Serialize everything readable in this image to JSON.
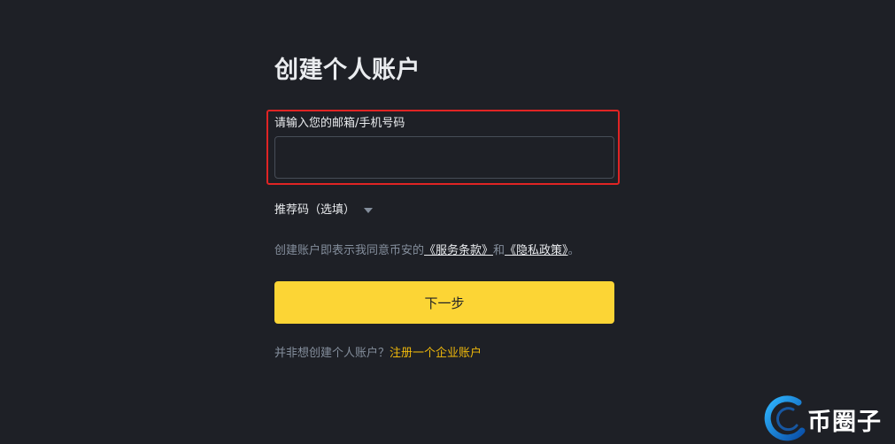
{
  "form": {
    "title": "创建个人账户",
    "email_phone_label": "请输入您的邮箱/手机号码",
    "email_phone_value": "",
    "email_phone_placeholder": "",
    "referral_label": "推荐码（选填）",
    "terms_prefix": "创建账户即表示我同意币安的",
    "terms_link": "《服务条款》",
    "terms_and": "和",
    "privacy_link": "《隐私政策》",
    "terms_suffix": "。",
    "next_button": "下一步",
    "alt_prefix": "并非想创建个人账户？",
    "alt_link": "注册一个企业账户"
  },
  "watermark": {
    "text": "币圈子"
  },
  "colors": {
    "background": "#1e2026",
    "primary_button": "#fcd535",
    "link_accent": "#f0b90b",
    "highlight_border": "#e02424",
    "muted_text": "#848e9c"
  },
  "icons": {
    "referral_toggle": "caret-down-icon",
    "watermark_logo": "ring-logo-icon"
  }
}
